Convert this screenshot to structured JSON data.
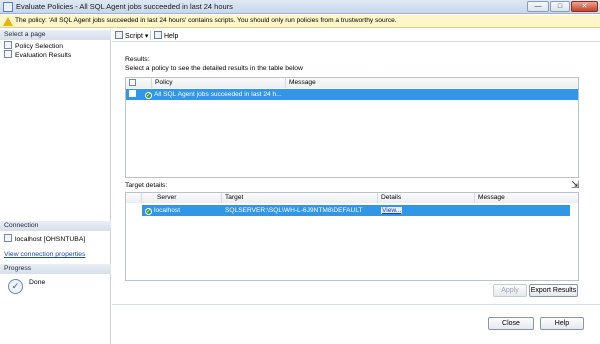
{
  "window": {
    "title": "Evaluate Policies - All SQL Agent jobs succeeded in last 24 hours",
    "minimize_glyph": "—",
    "maximize_glyph": "□",
    "close_glyph": "✕"
  },
  "warning": {
    "text": "The policy: 'All SQL Agent jobs succeeded in last 24 hours' contains scripts. You should only run policies from a trustworthy source."
  },
  "sidebar": {
    "select_page_header": "Select a page",
    "pages": [
      {
        "label": "Policy Selection",
        "icon": "page-icon"
      },
      {
        "label": "Evaluation Results",
        "icon": "page-icon"
      }
    ],
    "connection_header": "Connection",
    "connection_value": "localhost [OHSNTUBA]",
    "view_connection_link": "View connection properties",
    "progress_header": "Progress",
    "progress_status": "Done"
  },
  "toolbar": {
    "script_label": "Script",
    "help_label": "Help"
  },
  "results": {
    "section_label": "Results:",
    "instruction": "Select a policy to see the detailed results in the table below",
    "columns": [
      "Policy",
      "Message"
    ],
    "rows": [
      {
        "policy": "All SQL Agent jobs succeeded in last 24 h...",
        "message": ""
      }
    ]
  },
  "target_details": {
    "section_label": "Target details:",
    "columns": [
      "Server",
      "Target",
      "Details",
      "Message"
    ],
    "rows": [
      {
        "server": "localhost",
        "target": "SQLSERVER:\\SQL\\WH-L-6J9NTM8\\DEFAULT",
        "details": "View...",
        "message": ""
      }
    ]
  },
  "buttons": {
    "apply": "Apply",
    "export": "Export Results",
    "close": "Close",
    "help": "Help"
  },
  "colors": {
    "selection": "#3296e6",
    "warning_bg": "#fdf6c8",
    "link": "#1b4aa8"
  }
}
